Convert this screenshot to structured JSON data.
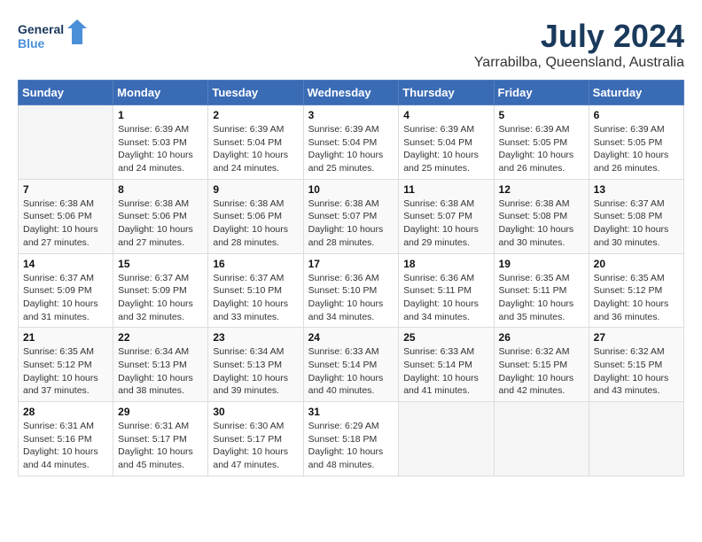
{
  "logo": {
    "line1": "General",
    "line2": "Blue"
  },
  "title": "July 2024",
  "location": "Yarrabilba, Queensland, Australia",
  "headers": [
    "Sunday",
    "Monday",
    "Tuesday",
    "Wednesday",
    "Thursday",
    "Friday",
    "Saturday"
  ],
  "weeks": [
    [
      {
        "day": "",
        "info": ""
      },
      {
        "day": "1",
        "info": "Sunrise: 6:39 AM\nSunset: 5:03 PM\nDaylight: 10 hours\nand 24 minutes."
      },
      {
        "day": "2",
        "info": "Sunrise: 6:39 AM\nSunset: 5:04 PM\nDaylight: 10 hours\nand 24 minutes."
      },
      {
        "day": "3",
        "info": "Sunrise: 6:39 AM\nSunset: 5:04 PM\nDaylight: 10 hours\nand 25 minutes."
      },
      {
        "day": "4",
        "info": "Sunrise: 6:39 AM\nSunset: 5:04 PM\nDaylight: 10 hours\nand 25 minutes."
      },
      {
        "day": "5",
        "info": "Sunrise: 6:39 AM\nSunset: 5:05 PM\nDaylight: 10 hours\nand 26 minutes."
      },
      {
        "day": "6",
        "info": "Sunrise: 6:39 AM\nSunset: 5:05 PM\nDaylight: 10 hours\nand 26 minutes."
      }
    ],
    [
      {
        "day": "7",
        "info": "Sunrise: 6:38 AM\nSunset: 5:06 PM\nDaylight: 10 hours\nand 27 minutes."
      },
      {
        "day": "8",
        "info": "Sunrise: 6:38 AM\nSunset: 5:06 PM\nDaylight: 10 hours\nand 27 minutes."
      },
      {
        "day": "9",
        "info": "Sunrise: 6:38 AM\nSunset: 5:06 PM\nDaylight: 10 hours\nand 28 minutes."
      },
      {
        "day": "10",
        "info": "Sunrise: 6:38 AM\nSunset: 5:07 PM\nDaylight: 10 hours\nand 28 minutes."
      },
      {
        "day": "11",
        "info": "Sunrise: 6:38 AM\nSunset: 5:07 PM\nDaylight: 10 hours\nand 29 minutes."
      },
      {
        "day": "12",
        "info": "Sunrise: 6:38 AM\nSunset: 5:08 PM\nDaylight: 10 hours\nand 30 minutes."
      },
      {
        "day": "13",
        "info": "Sunrise: 6:37 AM\nSunset: 5:08 PM\nDaylight: 10 hours\nand 30 minutes."
      }
    ],
    [
      {
        "day": "14",
        "info": "Sunrise: 6:37 AM\nSunset: 5:09 PM\nDaylight: 10 hours\nand 31 minutes."
      },
      {
        "day": "15",
        "info": "Sunrise: 6:37 AM\nSunset: 5:09 PM\nDaylight: 10 hours\nand 32 minutes."
      },
      {
        "day": "16",
        "info": "Sunrise: 6:37 AM\nSunset: 5:10 PM\nDaylight: 10 hours\nand 33 minutes."
      },
      {
        "day": "17",
        "info": "Sunrise: 6:36 AM\nSunset: 5:10 PM\nDaylight: 10 hours\nand 34 minutes."
      },
      {
        "day": "18",
        "info": "Sunrise: 6:36 AM\nSunset: 5:11 PM\nDaylight: 10 hours\nand 34 minutes."
      },
      {
        "day": "19",
        "info": "Sunrise: 6:35 AM\nSunset: 5:11 PM\nDaylight: 10 hours\nand 35 minutes."
      },
      {
        "day": "20",
        "info": "Sunrise: 6:35 AM\nSunset: 5:12 PM\nDaylight: 10 hours\nand 36 minutes."
      }
    ],
    [
      {
        "day": "21",
        "info": "Sunrise: 6:35 AM\nSunset: 5:12 PM\nDaylight: 10 hours\nand 37 minutes."
      },
      {
        "day": "22",
        "info": "Sunrise: 6:34 AM\nSunset: 5:13 PM\nDaylight: 10 hours\nand 38 minutes."
      },
      {
        "day": "23",
        "info": "Sunrise: 6:34 AM\nSunset: 5:13 PM\nDaylight: 10 hours\nand 39 minutes."
      },
      {
        "day": "24",
        "info": "Sunrise: 6:33 AM\nSunset: 5:14 PM\nDaylight: 10 hours\nand 40 minutes."
      },
      {
        "day": "25",
        "info": "Sunrise: 6:33 AM\nSunset: 5:14 PM\nDaylight: 10 hours\nand 41 minutes."
      },
      {
        "day": "26",
        "info": "Sunrise: 6:32 AM\nSunset: 5:15 PM\nDaylight: 10 hours\nand 42 minutes."
      },
      {
        "day": "27",
        "info": "Sunrise: 6:32 AM\nSunset: 5:15 PM\nDaylight: 10 hours\nand 43 minutes."
      }
    ],
    [
      {
        "day": "28",
        "info": "Sunrise: 6:31 AM\nSunset: 5:16 PM\nDaylight: 10 hours\nand 44 minutes."
      },
      {
        "day": "29",
        "info": "Sunrise: 6:31 AM\nSunset: 5:17 PM\nDaylight: 10 hours\nand 45 minutes."
      },
      {
        "day": "30",
        "info": "Sunrise: 6:30 AM\nSunset: 5:17 PM\nDaylight: 10 hours\nand 47 minutes."
      },
      {
        "day": "31",
        "info": "Sunrise: 6:29 AM\nSunset: 5:18 PM\nDaylight: 10 hours\nand 48 minutes."
      },
      {
        "day": "",
        "info": ""
      },
      {
        "day": "",
        "info": ""
      },
      {
        "day": "",
        "info": ""
      }
    ]
  ]
}
